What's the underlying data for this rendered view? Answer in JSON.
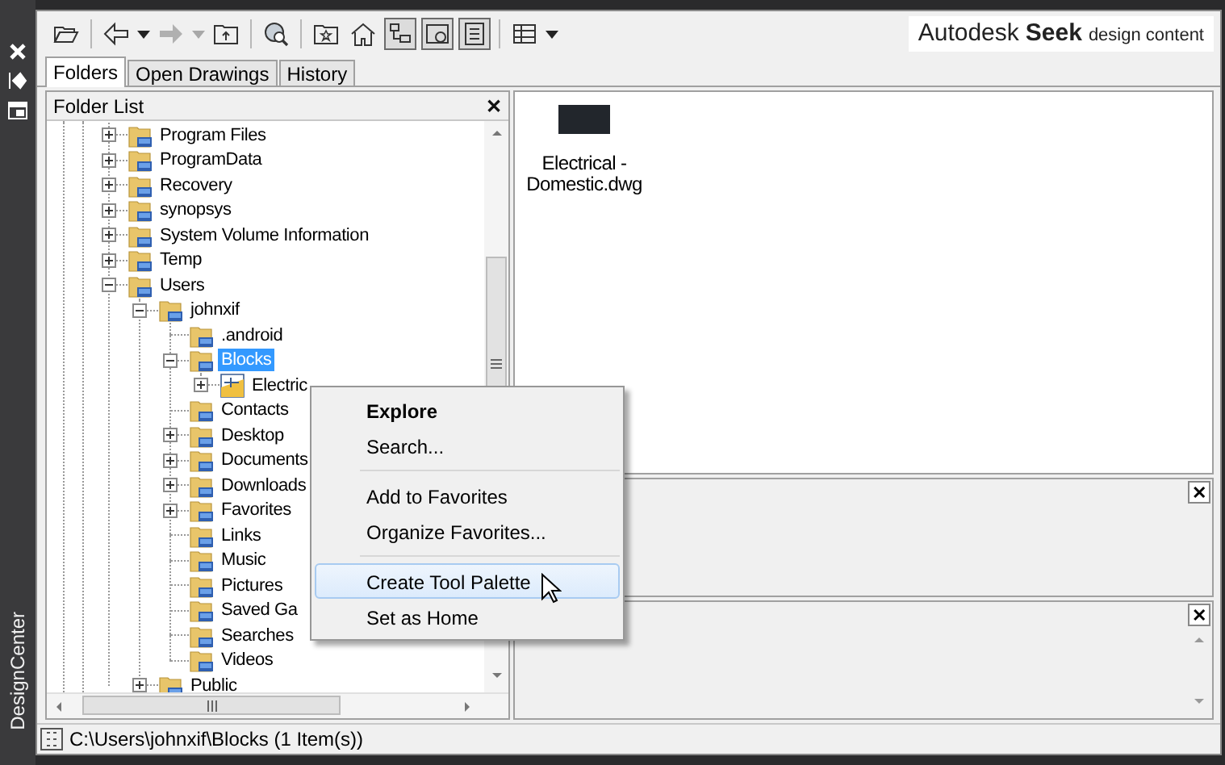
{
  "side_strip": {
    "title": "DesignCenter"
  },
  "toolbar": {
    "forward_disabled": true,
    "toggles": [
      {
        "kind": "tree",
        "pressed": true
      },
      {
        "kind": "preview",
        "pressed": true
      },
      {
        "kind": "description",
        "pressed": true
      }
    ]
  },
  "logo": {
    "brand": "Autodesk",
    "product": "Seek",
    "tagline": "design content"
  },
  "tabs": [
    {
      "label": "Folders",
      "selected": true
    },
    {
      "label": "Open Drawings",
      "selected": false
    },
    {
      "label": "History",
      "selected": false
    }
  ],
  "folder_list": {
    "title": "Folder List",
    "close": "✕",
    "tree": [
      {
        "label": "Program Files",
        "kind": "folder",
        "expanded": false,
        "selected": false
      },
      {
        "label": "ProgramData",
        "kind": "folder",
        "expanded": false,
        "selected": false
      },
      {
        "label": "Recovery",
        "kind": "folder",
        "expanded": false,
        "selected": false
      },
      {
        "label": "synopsys",
        "kind": "folder",
        "expanded": false,
        "selected": false
      },
      {
        "label": "System Volume Information",
        "kind": "folder",
        "expanded": false,
        "selected": false
      },
      {
        "label": "Temp",
        "kind": "folder",
        "expanded": false,
        "selected": false
      },
      {
        "label": "Users",
        "kind": "folder",
        "expanded": true,
        "selected": false,
        "children": [
          {
            "label": "johnxif",
            "kind": "folder",
            "expanded": true,
            "selected": false,
            "children": [
              {
                "label": ".android",
                "kind": "folder",
                "selected": false
              },
              {
                "label": "Blocks",
                "kind": "folder",
                "expanded": true,
                "selected": true,
                "children": [
                  {
                    "label": "Electric",
                    "kind": "drawing",
                    "expanded": false,
                    "selected": false
                  }
                ]
              },
              {
                "label": "Contacts",
                "kind": "folder",
                "selected": false
              },
              {
                "label": "Desktop",
                "kind": "folder",
                "expanded": false,
                "selected": false
              },
              {
                "label": "Documents",
                "kind": "folder",
                "expanded": false,
                "selected": false
              },
              {
                "label": "Downloads",
                "kind": "folder",
                "expanded": false,
                "selected": false
              },
              {
                "label": "Favorites",
                "kind": "folder",
                "expanded": false,
                "selected": false
              },
              {
                "label": "Links",
                "kind": "folder",
                "selected": false
              },
              {
                "label": "Music",
                "kind": "folder",
                "selected": false
              },
              {
                "label": "Pictures",
                "kind": "folder",
                "selected": false
              },
              {
                "label": "Saved Ga",
                "kind": "folder",
                "selected": false
              },
              {
                "label": "Searches",
                "kind": "folder",
                "selected": false
              },
              {
                "label": "Videos",
                "kind": "folder",
                "selected": false
              }
            ]
          },
          {
            "label": "Public",
            "kind": "folder",
            "expanded": false,
            "selected": false
          }
        ]
      }
    ]
  },
  "content": {
    "items": [
      {
        "label": "Electrical - Domestic.dwg"
      }
    ]
  },
  "preview_pane": {
    "close": "✕"
  },
  "description_pane": {
    "close": "✕"
  },
  "context_menu": [
    {
      "kind": "item",
      "label": "Explore",
      "default": true,
      "highlighted": false
    },
    {
      "kind": "item",
      "label": "Search...",
      "default": false,
      "highlighted": false
    },
    {
      "kind": "separator"
    },
    {
      "kind": "item",
      "label": "Add to Favorites",
      "default": false,
      "highlighted": false
    },
    {
      "kind": "item",
      "label": "Organize Favorites...",
      "default": false,
      "highlighted": false
    },
    {
      "kind": "separator"
    },
    {
      "kind": "item",
      "label": "Create Tool Palette",
      "default": false,
      "highlighted": true
    },
    {
      "kind": "item",
      "label": "Set as Home",
      "default": false,
      "highlighted": false
    }
  ],
  "status_bar": {
    "text": "C:\\Users\\johnxif\\Blocks (1 Item(s))"
  }
}
